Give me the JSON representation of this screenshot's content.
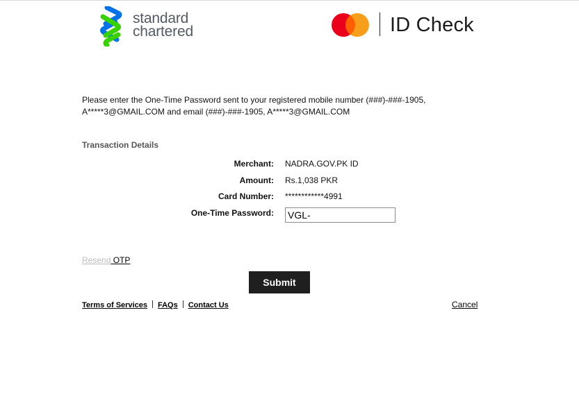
{
  "brand": {
    "bank_line1": "standard",
    "bank_line2": "chartered",
    "scheme_label": "ID Check",
    "colors": {
      "sc_blue": "#0473ea",
      "sc_green": "#38d200",
      "mc_red": "#eb001b",
      "mc_orange": "#f79e1b",
      "mc_overlap": "#ff5f00"
    }
  },
  "instructions": {
    "line1": "Please enter the One-Time Password sent to your registered mobile number (###)-###-1905,",
    "line2": "A*****3@GMAIL.COM and email (###)-###-1905, A*****3@GMAIL.COM"
  },
  "transaction": {
    "title": "Transaction Details",
    "merchant_label": "Merchant:",
    "merchant_value": "NADRA.GOV.PK ID",
    "amount_label": "Amount:",
    "amount_value": "Rs.1,038 PKR",
    "card_label": "Card Number:",
    "card_value": "************4991",
    "otp_label": "One-Time Password:",
    "otp_value": "VGL-"
  },
  "actions": {
    "resend_part1": "Resend",
    "resend_part2": " OTP",
    "submit_label": "Submit",
    "cancel_label": "Cancel"
  },
  "footer": {
    "terms": "Terms of Services",
    "faqs": "FAQs",
    "contact": "Contact Us"
  }
}
